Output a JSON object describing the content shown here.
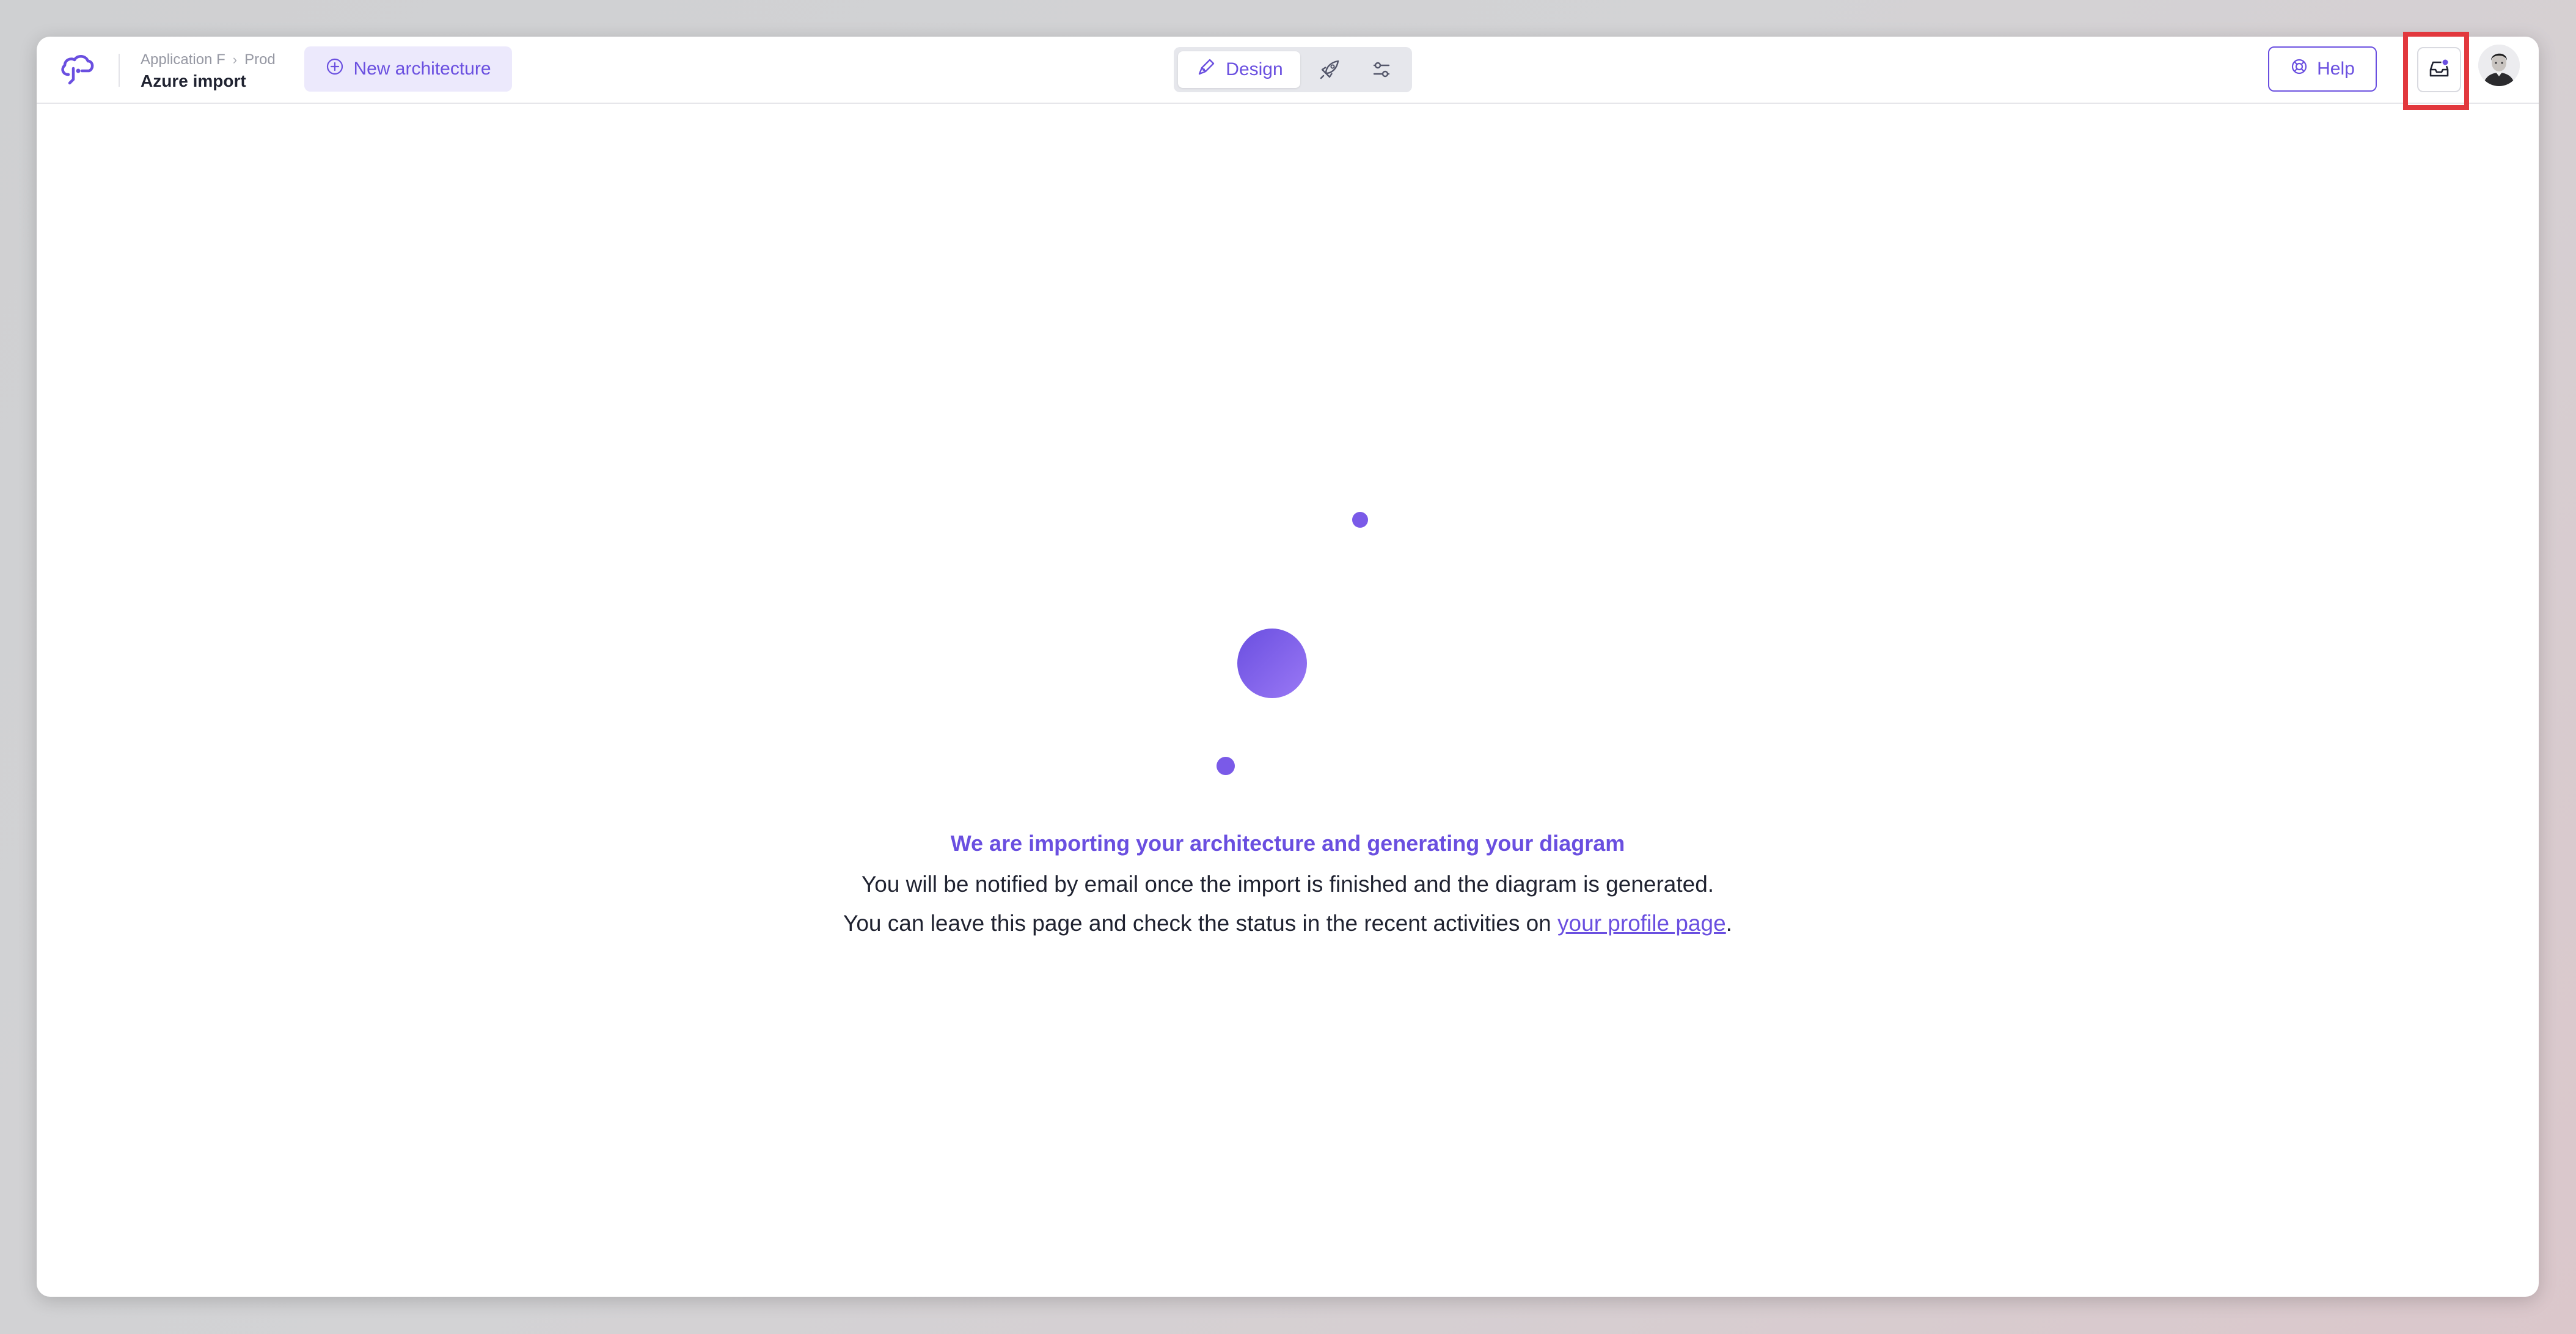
{
  "breadcrumb": {
    "application": "Application F",
    "environment": "Prod",
    "separator": "›"
  },
  "header": {
    "architecture_title": "Azure import",
    "new_architecture_label": "New architecture",
    "help_label": "Help"
  },
  "mode_toggle": {
    "design_label": "Design",
    "selected": "design",
    "icons": [
      "pen-icon",
      "rocket-icon",
      "sliders-icon"
    ]
  },
  "notifications": {
    "has_unread": true,
    "highlighted": true
  },
  "import_status": {
    "title": "We are importing your architecture and generating your diagram",
    "line1": "You will be notified by email once the import is finished and the diagram is generated.",
    "line2_prefix": "You can leave this page and check the status in the recent activities on ",
    "line2_link": "your profile page",
    "line2_suffix": "."
  },
  "colors": {
    "accent": "#6a4fe0",
    "accent_light": "#ece9fc",
    "highlight_border": "#e2383d",
    "text_dark": "#1f2230",
    "text_muted": "#9698a3"
  }
}
